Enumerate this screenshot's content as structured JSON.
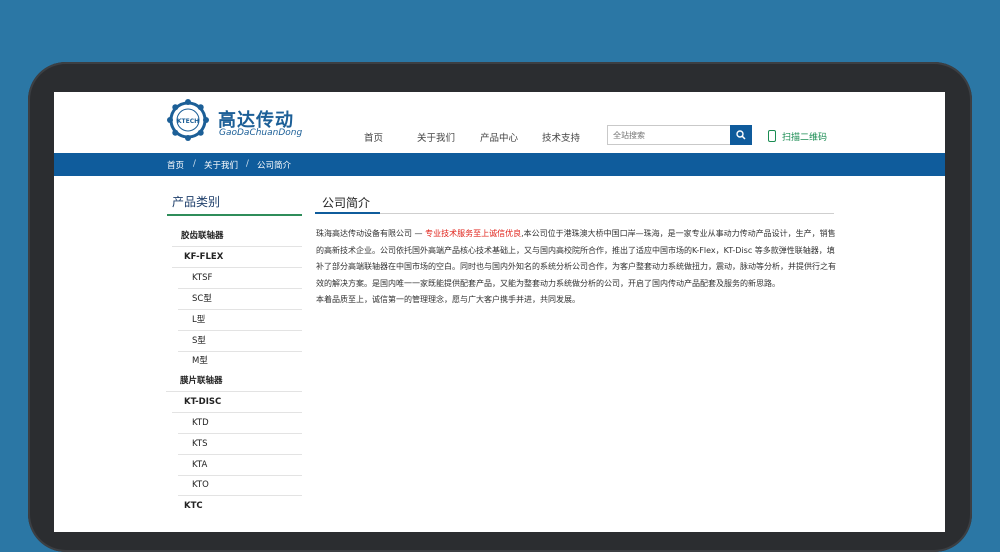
{
  "header": {
    "logo_mark_text": "KTECH",
    "logo_cn": "高达传动",
    "logo_en": "GaoDaChuanDong"
  },
  "nav": {
    "items": [
      "首页",
      "关于我们",
      "产品中心",
      "技术支持"
    ],
    "search_placeholder": "全站搜索",
    "qr_label": "扫描二维码"
  },
  "breadcrumb": [
    "首页",
    "关于我们",
    "公司简介"
  ],
  "sidebar": {
    "title": "产品类别",
    "items": [
      {
        "label": "胶齿联轴器",
        "level": "cat"
      },
      {
        "label": "KF-FLEX",
        "level": "sub"
      },
      {
        "label": "KTSF",
        "level": "leaf"
      },
      {
        "label": "SC型",
        "level": "leaf"
      },
      {
        "label": "L型",
        "level": "leaf"
      },
      {
        "label": "S型",
        "level": "leaf"
      },
      {
        "label": "M型",
        "level": "leaf"
      },
      {
        "label": "膜片联轴器",
        "level": "cat"
      },
      {
        "label": "KT-DISC",
        "level": "sub"
      },
      {
        "label": "KTD",
        "level": "leaf"
      },
      {
        "label": "KTS",
        "level": "leaf"
      },
      {
        "label": "KTA",
        "level": "leaf"
      },
      {
        "label": "KTO",
        "level": "leaf"
      },
      {
        "label": "KTC",
        "level": "sub"
      }
    ]
  },
  "main": {
    "title": "公司简介",
    "intro_prefix": "珠海高达传动设备有限公司 — ",
    "intro_highlight": "专业技术服务至上诚信优良",
    "intro_body": ",本公司位于港珠澳大桥中国口岸—珠海，是一家专业从事动力传动产品设计，生产，销售的高新技术企业。公司依托国外高端产品核心技术基础上，又与国内高校院所合作，推出了适应中国市场的K-Flex，KT-Disc 等多款弹性联轴器，填补了部分高端联轴器在中国市场的空白。同时也与国内外知名的系统分析公司合作，为客户整套动力系统做扭力，震动，脉动等分析，并提供行之有效的解决方案。是国内唯一一家既能提供配套产品，又能为整套动力系统做分析的公司，开启了国内传动产品配套及服务的新思路。",
    "intro_line2": "本着品质至上，诚信第一的管理理念，愿与广大客户携手并进，共同发展。"
  },
  "colors": {
    "page_bg": "#2b77a5",
    "brand_blue": "#0f5c9c",
    "accent_green": "#2f8d5a",
    "highlight_red": "#e0221a"
  }
}
